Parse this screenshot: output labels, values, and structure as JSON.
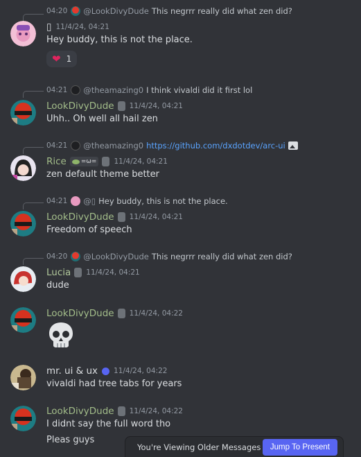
{
  "messages": [
    {
      "reply": {
        "time": "04:20",
        "username": "@LookDivyDude",
        "text": "This negrrr really did what zen did?"
      },
      "author": "▯",
      "timestamp": "11/4/24, 04:21",
      "lines": [
        "Hey buddy, this is not the place."
      ],
      "reaction": {
        "emoji": "❤",
        "count": "1"
      }
    },
    {
      "reply": {
        "time": "04:21",
        "username": "@theamazing0",
        "text": "I think vivaldi did it first lol"
      },
      "author": "LookDivyDude",
      "timestamp": "11/4/24, 04:21",
      "lines": [
        "Uhh.. Oh well all hail zen"
      ]
    },
    {
      "reply": {
        "time": "04:21",
        "username": "@theamazing0",
        "link": "https://github.com/dxdotdev/arc-ui"
      },
      "author": "Rice",
      "tag": "=ω=",
      "timestamp": "11/4/24, 04:21",
      "lines": [
        "zen default theme better"
      ]
    },
    {
      "reply": {
        "time": "04:21",
        "username": "@▯",
        "text": "Hey buddy, this is not the place."
      },
      "author": "LookDivyDude",
      "timestamp": "11/4/24, 04:21",
      "lines": [
        "Freedom of speech"
      ]
    },
    {
      "reply": {
        "time": "04:20",
        "username": "@LookDivyDude",
        "text": "This negrrr really did what zen did?"
      },
      "author": "Lucia",
      "timestamp": "11/4/24, 04:21",
      "lines": [
        "dude"
      ]
    },
    {
      "author": "LookDivyDude",
      "timestamp": "11/4/24, 04:22",
      "emoji": "skull"
    },
    {
      "author": "mr. ui & ux",
      "timestamp": "11/4/24, 04:22",
      "lines": [
        "vivaldi had tree tabs for years"
      ]
    },
    {
      "author": "LookDivyDude",
      "timestamp": "11/4/24, 04:22",
      "lines": [
        "I didnt say the full word tho",
        "Pleas guys"
      ]
    }
  ],
  "older_bar": {
    "label": "You're Viewing Older Messages",
    "jump_label": "Jump To Present"
  },
  "colors": {
    "background": "#313338",
    "accent": "#5865f2",
    "username_green": "#a3bd8a",
    "link": "#5aa4ff"
  }
}
